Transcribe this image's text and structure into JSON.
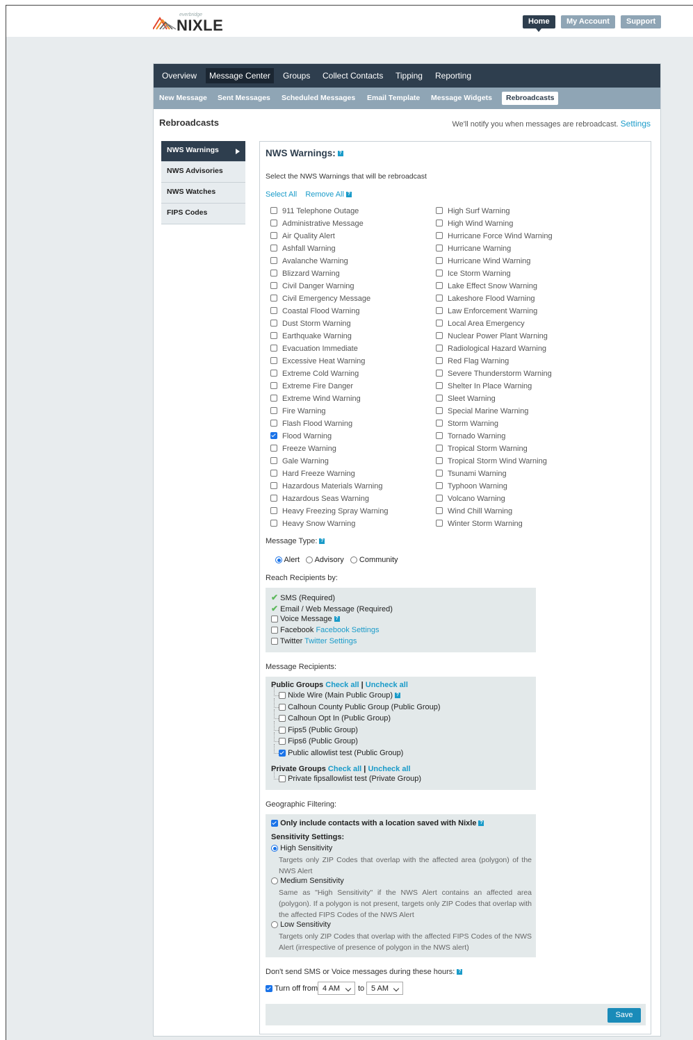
{
  "brand": {
    "small": "everbridge",
    "name": "NIXLE"
  },
  "topnav": {
    "home": "Home",
    "account": "My Account",
    "support": "Support"
  },
  "mainnav": [
    "Overview",
    "Message Center",
    "Groups",
    "Collect Contacts",
    "Tipping",
    "Reporting"
  ],
  "subnav": [
    "New Message",
    "Sent Messages",
    "Scheduled Messages",
    "Email Template",
    "Message Widgets",
    "Rebroadcasts"
  ],
  "page": {
    "title": "Rebroadcasts",
    "notify_text": "We'll notify you when messages are rebroadcast.",
    "settings_link": "Settings"
  },
  "sidemenu": [
    "NWS Warnings",
    "NWS Advisories",
    "NWS Watches",
    "FIPS Codes"
  ],
  "panel": {
    "title": "NWS Warnings:",
    "instruction": "Select the NWS Warnings that will be rebroadcast",
    "select_all": "Select All",
    "remove_all": "Remove All",
    "help_glyph": "?"
  },
  "warnings_left": [
    {
      "label": "911 Telephone Outage",
      "checked": false
    },
    {
      "label": "Administrative Message",
      "checked": false
    },
    {
      "label": "Air Quality Alert",
      "checked": false
    },
    {
      "label": "Ashfall Warning",
      "checked": false
    },
    {
      "label": "Avalanche Warning",
      "checked": false
    },
    {
      "label": "Blizzard Warning",
      "checked": false
    },
    {
      "label": "Civil Danger Warning",
      "checked": false
    },
    {
      "label": "Civil Emergency Message",
      "checked": false
    },
    {
      "label": "Coastal Flood Warning",
      "checked": false
    },
    {
      "label": "Dust Storm Warning",
      "checked": false
    },
    {
      "label": "Earthquake Warning",
      "checked": false
    },
    {
      "label": "Evacuation Immediate",
      "checked": false
    },
    {
      "label": "Excessive Heat Warning",
      "checked": false
    },
    {
      "label": "Extreme Cold Warning",
      "checked": false
    },
    {
      "label": "Extreme Fire Danger",
      "checked": false
    },
    {
      "label": "Extreme Wind Warning",
      "checked": false
    },
    {
      "label": "Fire Warning",
      "checked": false
    },
    {
      "label": "Flash Flood Warning",
      "checked": false
    },
    {
      "label": "Flood Warning",
      "checked": true
    },
    {
      "label": "Freeze Warning",
      "checked": false
    },
    {
      "label": "Gale Warning",
      "checked": false
    },
    {
      "label": "Hard Freeze Warning",
      "checked": false
    },
    {
      "label": "Hazardous Materials Warning",
      "checked": false
    },
    {
      "label": "Hazardous Seas Warning",
      "checked": false
    },
    {
      "label": "Heavy Freezing Spray Warning",
      "checked": false
    },
    {
      "label": "Heavy Snow Warning",
      "checked": false
    }
  ],
  "warnings_right": [
    {
      "label": "High Surf Warning",
      "checked": false
    },
    {
      "label": "High Wind Warning",
      "checked": false
    },
    {
      "label": "Hurricane Force Wind Warning",
      "checked": false
    },
    {
      "label": "Hurricane Warning",
      "checked": false
    },
    {
      "label": "Hurricane Wind Warning",
      "checked": false
    },
    {
      "label": "Ice Storm Warning",
      "checked": false
    },
    {
      "label": "Lake Effect Snow Warning",
      "checked": false
    },
    {
      "label": "Lakeshore Flood Warning",
      "checked": false
    },
    {
      "label": "Law Enforcement Warning",
      "checked": false
    },
    {
      "label": "Local Area Emergency",
      "checked": false
    },
    {
      "label": "Nuclear Power Plant Warning",
      "checked": false
    },
    {
      "label": "Radiological Hazard Warning",
      "checked": false
    },
    {
      "label": "Red Flag Warning",
      "checked": false
    },
    {
      "label": "Severe Thunderstorm Warning",
      "checked": false
    },
    {
      "label": "Shelter In Place Warning",
      "checked": false
    },
    {
      "label": "Sleet Warning",
      "checked": false
    },
    {
      "label": "Special Marine Warning",
      "checked": false
    },
    {
      "label": "Storm Warning",
      "checked": false
    },
    {
      "label": "Tornado Warning",
      "checked": false
    },
    {
      "label": "Tropical Storm Warning",
      "checked": false
    },
    {
      "label": "Tropical Storm Wind Warning",
      "checked": false
    },
    {
      "label": "Tsunami Warning",
      "checked": false
    },
    {
      "label": "Typhoon Warning",
      "checked": false
    },
    {
      "label": "Volcano Warning",
      "checked": false
    },
    {
      "label": "Wind Chill Warning",
      "checked": false
    },
    {
      "label": "Winter Storm Warning",
      "checked": false
    }
  ],
  "message_type": {
    "label": "Message Type:",
    "options": [
      "Alert",
      "Advisory",
      "Community"
    ],
    "selected": "Alert"
  },
  "reach": {
    "label": "Reach Recipients by:",
    "sms": "SMS (Required)",
    "email": "Email / Web Message (Required)",
    "voice": "Voice Message",
    "facebook": "Facebook",
    "facebook_link": "Facebook Settings",
    "twitter": "Twitter",
    "twitter_link": "Twitter Settings"
  },
  "recipients": {
    "label": "Message Recipients:",
    "public_heading": "Public Groups",
    "private_heading": "Private Groups",
    "check_all": "Check all",
    "separator": "|",
    "uncheck_all": "Uncheck all",
    "public_groups": [
      {
        "label": "Nixle Wire (Main Public Group)",
        "checked": false
      },
      {
        "label": "Calhoun County Public Group (Public Group)",
        "checked": false
      },
      {
        "label": "Calhoun Opt In (Public Group)",
        "checked": false
      },
      {
        "label": "Fips5 (Public Group)",
        "checked": false
      },
      {
        "label": "Fips6 (Public Group)",
        "checked": false
      },
      {
        "label": "Public allowlist test (Public Group)",
        "checked": true
      }
    ],
    "private_groups": [
      {
        "label": "Private fipsallowlist test (Private Group)",
        "checked": false
      }
    ]
  },
  "geo": {
    "label": "Geographic Filtering:",
    "only_include": "Only include contacts with a location saved with Nixle",
    "sensitivity_heading": "Sensitivity Settings:",
    "high": "High Sensitivity",
    "high_desc": "Targets only ZIP Codes that overlap with the affected area (polygon) of the NWS Alert",
    "medium": "Medium Sensitivity",
    "medium_desc": "Same as \"High Sensitivity\" if the NWS Alert contains an affected area (polygon). If a polygon is not present, targets only ZIP Codes that overlap with the affected FIPS Codes of the NWS Alert",
    "low": "Low Sensitivity",
    "low_desc": "Targets only ZIP Codes that overlap with the affected FIPS Codes of the NWS Alert (irrespective of presence of polygon in the NWS alert)",
    "selected": "High Sensitivity"
  },
  "quiet": {
    "label": "Don't send SMS or Voice messages during these hours:",
    "turn_off_from": "Turn off from",
    "from_value": "4 AM",
    "to": "to",
    "to_value": "5 AM"
  },
  "save_label": "Save",
  "colors": {
    "nav_dark": "#2e3e4e",
    "subnav": "#8fa5b5",
    "accent": "#1a9bc9",
    "save": "#1a8bb9"
  }
}
